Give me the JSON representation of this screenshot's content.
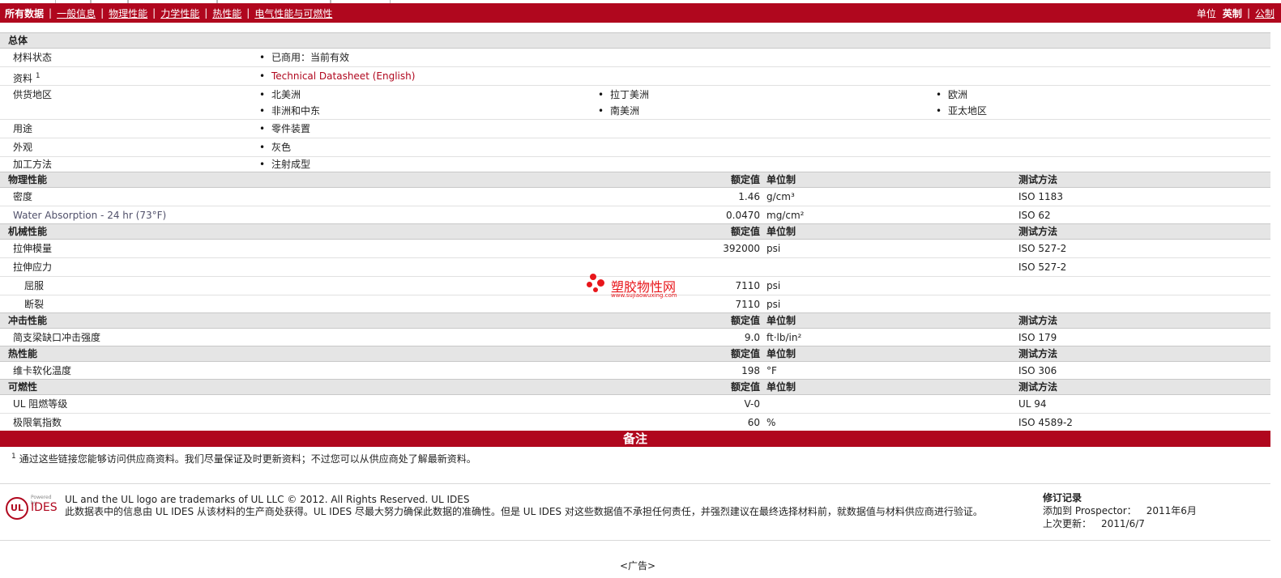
{
  "nav": {
    "tabs": [
      {
        "label": "所有数据"
      },
      {
        "label": "一般信息"
      },
      {
        "label": "物理性能"
      },
      {
        "label": "力学性能"
      },
      {
        "label": "热性能"
      },
      {
        "label": "电气性能与可燃性"
      }
    ],
    "separator": "|",
    "unit_label": "单位",
    "unit_imperial": "英制",
    "unit_metric": "公制"
  },
  "columns": {
    "nominal": "额定值",
    "unit": "单位制",
    "test": "测试方法"
  },
  "general": {
    "title": "总体",
    "status_label": "材料状态",
    "status_value": "已商用：当前有效",
    "docs_label": "资料",
    "docs_sup": "1",
    "docs_value": "Technical Datasheet (English)",
    "regions_label": "供货地区",
    "regions": [
      "北美洲",
      "拉丁美洲",
      "欧洲",
      "非洲和中东",
      "南美洲",
      "亚太地区"
    ],
    "use_label": "用途",
    "use_value": "零件装置",
    "appearance_label": "外观",
    "appearance_value": "灰色",
    "process_label": "加工方法",
    "process_value": "注射成型"
  },
  "physical": {
    "title": "物理性能",
    "rows": [
      {
        "label": "密度",
        "value": "1.46",
        "unit": "g/cm³",
        "test": "ISO 1183"
      },
      {
        "label": "Water Absorption - 24 hr (73°F)",
        "value": "0.0470",
        "unit": "mg/cm²",
        "test": "ISO 62"
      }
    ]
  },
  "mechanical": {
    "title": "机械性能",
    "rows": [
      {
        "label": "拉伸模量",
        "value": "392000",
        "unit": "psi",
        "test": "ISO 527-2"
      },
      {
        "label": "拉伸应力",
        "value": "",
        "unit": "",
        "test": "ISO 527-2"
      },
      {
        "label": "屈服",
        "value": "7110",
        "unit": "psi",
        "test": ""
      },
      {
        "label": "断裂",
        "value": "7110",
        "unit": "psi",
        "test": ""
      }
    ]
  },
  "impact": {
    "title": "冲击性能",
    "rows": [
      {
        "label": "简支梁缺口冲击强度",
        "value": "9.0",
        "unit": "ft·lb/in²",
        "test": "ISO 179"
      }
    ]
  },
  "thermal": {
    "title": "热性能",
    "rows": [
      {
        "label": "维卡软化温度",
        "value": "198",
        "unit": "°F",
        "test": "ISO 306"
      }
    ]
  },
  "flammability": {
    "title": "可燃性",
    "rows": [
      {
        "label": "UL 阻燃等级",
        "value": "V-0",
        "unit": "",
        "test": "UL 94"
      },
      {
        "label": "极限氧指数",
        "value": "60",
        "unit": "%",
        "test": "ISO 4589-2"
      }
    ]
  },
  "notes": {
    "title": "备注",
    "sup": "1",
    "text": "通过这些链接您能够访问供应商资料。我们尽量保证及时更新资料；不过您可以从供应商处了解最新资料。"
  },
  "footer": {
    "logo_ul": "UL",
    "logo_powered": "Powered by",
    "logo_ides": "IDES",
    "trademark": "UL and the UL logo are trademarks of UL LLC © 2012. All Rights Reserved. UL IDES",
    "disclaimer": "此数据表中的信息由 UL IDES 从该材料的生产商处获得。UL IDES 尽最大努力确保此数据的准确性。但是 UL IDES 对这些数据值不承担任何责任，并强烈建议在最终选择材料前，就数据值与材料供应商进行验证。",
    "revision_title": "修订记录",
    "added_label": "添加到 Prospector：",
    "added_value": "2011年6月",
    "updated_label": "上次更新：",
    "updated_value": "2011/6/7"
  },
  "ad_label": "<广告>",
  "watermark": {
    "title": "塑胶物性网",
    "url": "www.sujiaowuxing.com"
  }
}
